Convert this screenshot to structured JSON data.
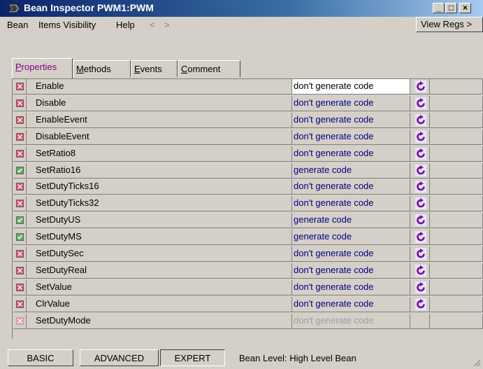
{
  "window": {
    "title": "Bean Inspector PWM1:PWM",
    "minimize_label": "_",
    "maximize_label": "□",
    "close_label": "×"
  },
  "menu": {
    "items": [
      "Bean",
      "Items Visibility",
      "Help"
    ],
    "back_label": "<",
    "forward_label": ">",
    "view_regs_label": "View Regs >"
  },
  "tabs": [
    {
      "pre": "",
      "key": "P",
      "post": "roperties",
      "active": true
    },
    {
      "pre": "",
      "key": "M",
      "post": "ethods",
      "active": false
    },
    {
      "pre": "",
      "key": "E",
      "post": "vents",
      "active": false
    },
    {
      "pre": "",
      "key": "C",
      "post": "omment",
      "active": false
    }
  ],
  "methods": [
    {
      "name": "Enable",
      "value": "don't generate code",
      "state": "off"
    },
    {
      "name": "Disable",
      "value": "don't generate code",
      "state": "off"
    },
    {
      "name": "EnableEvent",
      "value": "don't generate code",
      "state": "off"
    },
    {
      "name": "DisableEvent",
      "value": "don't generate code",
      "state": "off"
    },
    {
      "name": "SetRatio8",
      "value": "don't generate code",
      "state": "off"
    },
    {
      "name": "SetRatio16",
      "value": "generate code",
      "state": "on"
    },
    {
      "name": "SetDutyTicks16",
      "value": "don't generate code",
      "state": "off"
    },
    {
      "name": "SetDutyTicks32",
      "value": "don't generate code",
      "state": "off"
    },
    {
      "name": "SetDutyUS",
      "value": "generate code",
      "state": "on"
    },
    {
      "name": "SetDutyMS",
      "value": "generate code",
      "state": "on"
    },
    {
      "name": "SetDutySec",
      "value": "don't generate code",
      "state": "off"
    },
    {
      "name": "SetDutyReal",
      "value": "don't generate code",
      "state": "off"
    },
    {
      "name": "SetValue",
      "value": "don't generate code",
      "state": "off"
    },
    {
      "name": "ClrValue",
      "value": "don't generate code",
      "state": "off"
    },
    {
      "name": "SetDutyMode",
      "value": "don't generate code",
      "state": "disabled"
    }
  ],
  "status": {
    "basic_label": "BASIC",
    "advanced_label": "ADVANCED",
    "expert_label": "EXPERT",
    "level_text": "Bean Level: High Level Bean"
  },
  "colors": {
    "title_gradient_start": "#0a246a",
    "value_text": "#000080",
    "checkbox_off": "#e05060",
    "checkbox_on": "#60b060",
    "active_tab": "#800080"
  }
}
